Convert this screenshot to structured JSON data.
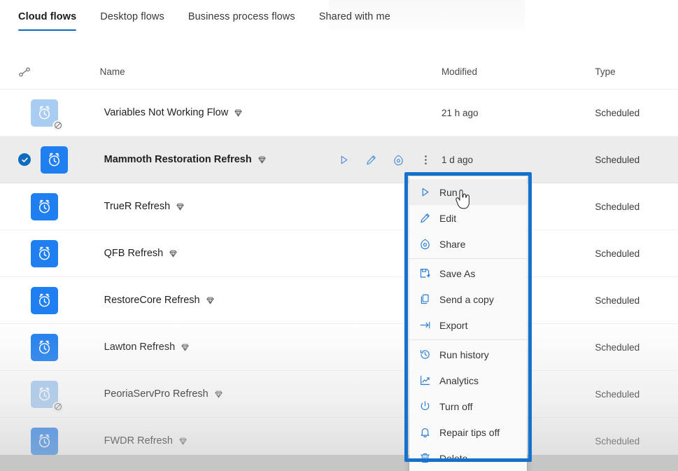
{
  "tabs": [
    {
      "label": "Cloud flows",
      "active": true
    },
    {
      "label": "Desktop flows",
      "active": false
    },
    {
      "label": "Business process flows",
      "active": false
    },
    {
      "label": "Shared with me",
      "active": false
    }
  ],
  "table": {
    "headers": {
      "sort": "",
      "name": "Name",
      "modified": "Modified",
      "type": "Type"
    },
    "rows": [
      {
        "name": "Variables Not Working Flow",
        "modified": "21 h ago",
        "type": "Scheduled",
        "enabled": false,
        "selected": false,
        "premium": true
      },
      {
        "name": "Mammoth Restoration Refresh",
        "modified": "1 d ago",
        "type": "Scheduled",
        "enabled": true,
        "selected": true,
        "premium": true
      },
      {
        "name": "TrueR Refresh",
        "modified": "",
        "type": "Scheduled",
        "enabled": true,
        "selected": false,
        "premium": true
      },
      {
        "name": "QFB Refresh",
        "modified": "",
        "type": "Scheduled",
        "enabled": true,
        "selected": false,
        "premium": true
      },
      {
        "name": "RestoreCore Refresh",
        "modified": "",
        "type": "Scheduled",
        "enabled": true,
        "selected": false,
        "premium": true
      },
      {
        "name": "Lawton Refresh",
        "modified": "",
        "type": "Scheduled",
        "enabled": true,
        "selected": false,
        "premium": true
      },
      {
        "name": "PeoriaServPro Refresh",
        "modified": "",
        "type": "Scheduled",
        "enabled": false,
        "selected": false,
        "premium": true
      },
      {
        "name": "FWDR Refresh",
        "modified": "",
        "type": "Scheduled",
        "enabled": true,
        "selected": false,
        "premium": true
      }
    ]
  },
  "row_actions": [
    {
      "name": "run-action",
      "icon": "play-icon"
    },
    {
      "name": "edit-action",
      "icon": "pencil-icon"
    },
    {
      "name": "share-action",
      "icon": "share-icon"
    },
    {
      "name": "more-action",
      "icon": "ellipsis-vertical-icon"
    }
  ],
  "context_menu": [
    {
      "label": "Run",
      "icon": "play-icon",
      "hover": true,
      "separator_after": false
    },
    {
      "label": "Edit",
      "icon": "pencil-icon",
      "hover": false,
      "separator_after": false
    },
    {
      "label": "Share",
      "icon": "share-icon",
      "hover": false,
      "separator_after": true
    },
    {
      "label": "Save As",
      "icon": "save-as-icon",
      "hover": false,
      "separator_after": false
    },
    {
      "label": "Send a copy",
      "icon": "copy-icon",
      "hover": false,
      "separator_after": false
    },
    {
      "label": "Export",
      "icon": "export-icon",
      "hover": false,
      "separator_after": true
    },
    {
      "label": "Run history",
      "icon": "history-icon",
      "hover": false,
      "separator_after": false
    },
    {
      "label": "Analytics",
      "icon": "analytics-icon",
      "hover": false,
      "separator_after": false
    },
    {
      "label": "Turn off",
      "icon": "power-icon",
      "hover": false,
      "separator_after": false
    },
    {
      "label": "Repair tips off",
      "icon": "bell-icon",
      "hover": false,
      "separator_after": false
    },
    {
      "label": "Delete",
      "icon": "trash-icon",
      "hover": false,
      "separator_after": false
    }
  ],
  "colors": {
    "accent": "#0f6cbd",
    "flow_icon": "#1f7ff0",
    "flow_icon_disabled": "#a8ccf2",
    "annotation_box": "#1572cc",
    "selected_row": "#ececec",
    "menu_icon": "#2b7cd3"
  }
}
